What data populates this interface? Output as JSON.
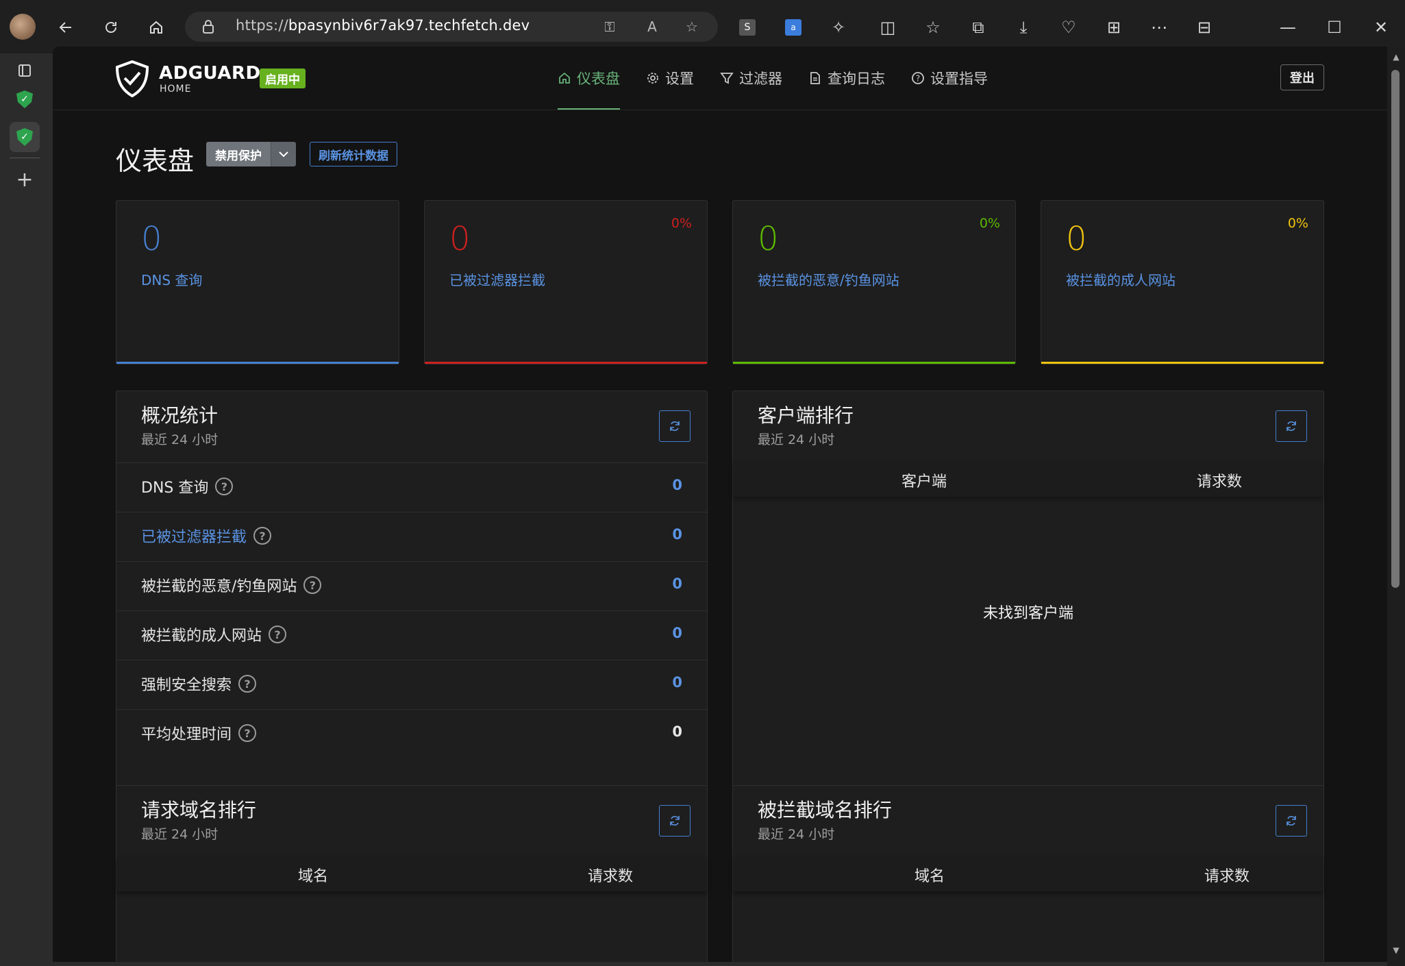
{
  "browser": {
    "url_prefix": "https://",
    "url_host": "bpasynbiv6r7ak97.techfetch.dev"
  },
  "app": {
    "brand": "ADGUARD",
    "brand_sub": "HOME",
    "status_badge": "启用中",
    "nav": [
      {
        "label": "仪表盘",
        "icon": "home-icon",
        "active": true
      },
      {
        "label": "设置",
        "icon": "gear-icon",
        "active": false
      },
      {
        "label": "过滤器",
        "icon": "filter-icon",
        "active": false
      },
      {
        "label": "查询日志",
        "icon": "document-icon",
        "active": false
      },
      {
        "label": "设置指导",
        "icon": "help-icon",
        "active": false
      }
    ],
    "logout_label": "登出"
  },
  "page": {
    "title": "仪表盘",
    "disable_protection_label": "禁用保护",
    "refresh_stats_label": "刷新统计数据"
  },
  "stats_cards": [
    {
      "value": "0",
      "label": "DNS 查询",
      "percent": "",
      "color": "#467fcf"
    },
    {
      "value": "0",
      "label": "已被过滤器拦截",
      "percent": "0%",
      "color": "#cd201f"
    },
    {
      "value": "0",
      "label": "被拦截的恶意/钓鱼网站",
      "percent": "0%",
      "color": "#5eba00"
    },
    {
      "value": "0",
      "label": "被拦截的成人网站",
      "percent": "0%",
      "color": "#f1c40f"
    }
  ],
  "overview": {
    "title": "概况统计",
    "subtitle": "最近 24 小时",
    "rows": [
      {
        "label": "DNS 查询",
        "value": "0"
      },
      {
        "label": "已被过滤器拦截",
        "value": "0"
      },
      {
        "label": "被拦截的恶意/钓鱼网站",
        "value": "0"
      },
      {
        "label": "被拦截的成人网站",
        "value": "0"
      },
      {
        "label": "强制安全搜索",
        "value": "0"
      },
      {
        "label": "平均处理时间",
        "value": "0"
      }
    ]
  },
  "top_clients": {
    "title": "客户端排行",
    "subtitle": "最近 24 小时",
    "col_client": "客户端",
    "col_requests": "请求数",
    "empty": "未找到客户端"
  },
  "top_queried": {
    "title": "请求域名排行",
    "subtitle": "最近 24 小时",
    "col_domain": "域名",
    "col_requests": "请求数"
  },
  "top_blocked": {
    "title": "被拦截域名排行",
    "subtitle": "最近 24 小时",
    "col_domain": "域名",
    "col_requests": "请求数"
  }
}
